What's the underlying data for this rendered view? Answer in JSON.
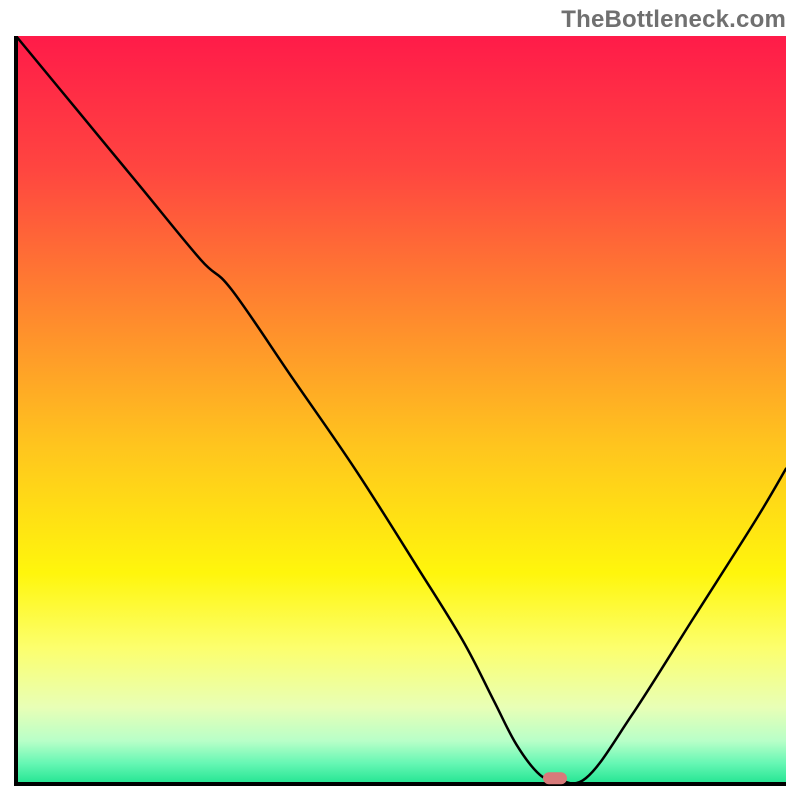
{
  "watermark": "TheBottleneck.com",
  "chart_data": {
    "type": "line",
    "title": "",
    "xlabel": "",
    "ylabel": "",
    "xlim": [
      0,
      100
    ],
    "ylim": [
      0,
      100
    ],
    "grid": false,
    "legend": false,
    "background_gradient": {
      "stops": [
        {
          "offset": 0.0,
          "color": "#ff1b49"
        },
        {
          "offset": 0.18,
          "color": "#ff4640"
        },
        {
          "offset": 0.38,
          "color": "#ff8b2d"
        },
        {
          "offset": 0.55,
          "color": "#ffc51e"
        },
        {
          "offset": 0.72,
          "color": "#fff60c"
        },
        {
          "offset": 0.82,
          "color": "#fcff6d"
        },
        {
          "offset": 0.9,
          "color": "#e8ffb6"
        },
        {
          "offset": 0.945,
          "color": "#b8ffc8"
        },
        {
          "offset": 0.975,
          "color": "#66f7b4"
        },
        {
          "offset": 1.0,
          "color": "#29e695"
        }
      ]
    },
    "series": [
      {
        "name": "bottleneck-curve",
        "x": [
          0,
          8,
          16,
          24,
          28,
          36,
          44,
          52,
          58,
          62,
          65,
          68,
          70,
          74,
          80,
          88,
          96,
          100
        ],
        "y": [
          100,
          90,
          80,
          70,
          66,
          54,
          42,
          29,
          19,
          11,
          5,
          1,
          0.5,
          0.5,
          9,
          22,
          35,
          42
        ]
      }
    ],
    "marker": {
      "name": "highlight-pill",
      "x": 70,
      "y": 0.5,
      "color": "#d87a7a"
    }
  }
}
